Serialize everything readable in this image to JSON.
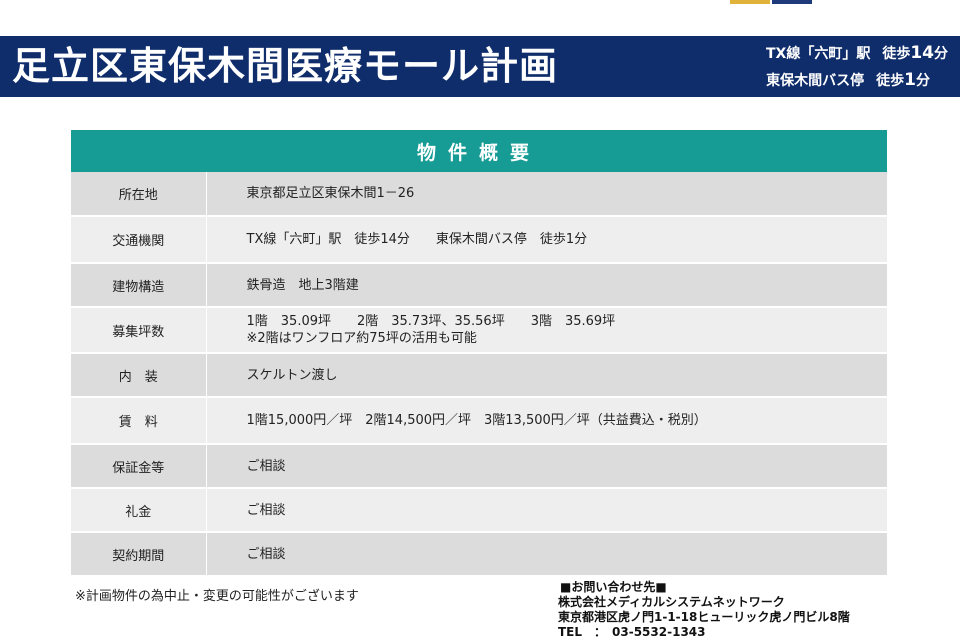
{
  "colors": {
    "banner_bg": "#0f2d6b",
    "table_header_bg": "#169c95",
    "row_dark": "#dcdcdc",
    "row_light": "#eeeeee",
    "logo_gold": "#e0b23a",
    "logo_navy": "#1f3a7a"
  },
  "banner": {
    "title": "足立区東保木間医療モール計画",
    "access": [
      {
        "place": "TX線「六町」駅",
        "walk_label": "徒歩",
        "minutes": "14",
        "unit": "分"
      },
      {
        "place": "東保木間バス停",
        "walk_label": "徒歩",
        "minutes": "1",
        "unit": "分"
      }
    ]
  },
  "summary": {
    "title": "物件概要",
    "rows": [
      {
        "label": "所在地",
        "lines": [
          "東京都足立区東保木間1－26"
        ]
      },
      {
        "label": "交通機関",
        "lines": [
          "TX線「六町」駅　徒歩14分　　東保木間バス停　徒歩1分"
        ]
      },
      {
        "label": "建物構造",
        "lines": [
          "鉄骨造　地上3階建"
        ]
      },
      {
        "label": "募集坪数",
        "lines": [
          "1階　35.09坪　　2階　35.73坪、35.56坪　　3階　35.69坪",
          "※2階はワンフロア約75坪の活用も可能"
        ]
      },
      {
        "label": "内　装",
        "lines": [
          "スケルトン渡し"
        ]
      },
      {
        "label": "賃　料",
        "lines": [
          "1階15,000円／坪　2階14,500円／坪　3階13,500円／坪（共益費込・税別）"
        ]
      },
      {
        "label": "保証金等",
        "lines": [
          "ご相談"
        ]
      },
      {
        "label": "礼金",
        "lines": [
          "ご相談"
        ]
      },
      {
        "label": "契約期間",
        "lines": [
          "ご相談"
        ]
      }
    ]
  },
  "note": "※計画物件の為中止・変更の可能性がございます",
  "contact": {
    "heading": "■お問い合わせ先■",
    "company": "株式会社メディカルシステムネットワーク",
    "address": "東京都港区虎ノ門1-1-18ヒューリック虎ノ門ビル8階",
    "tel": "TEL　：　03-5532-1343"
  }
}
